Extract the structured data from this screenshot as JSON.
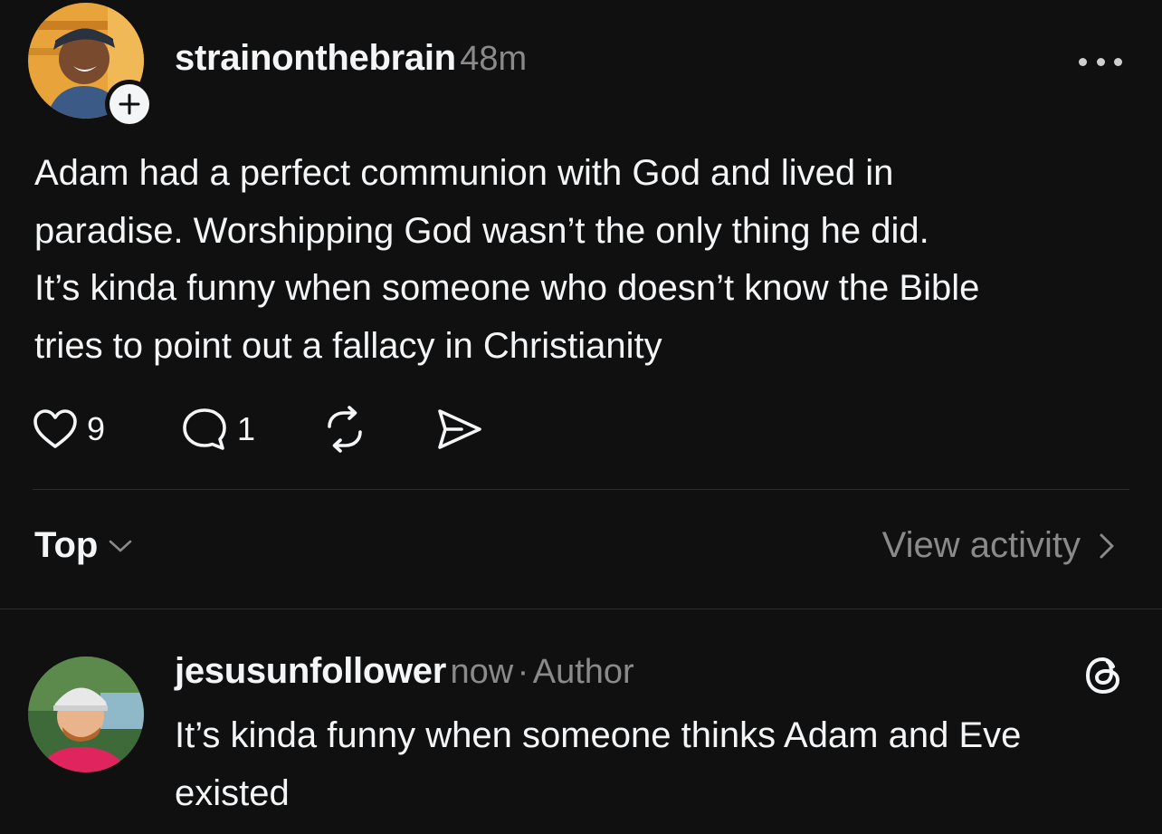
{
  "post": {
    "username": "strainonthebrain",
    "time": "48m",
    "text": "Adam had a perfect communion with God and lived in\nparadise. Worshipping God wasn’t the only thing he did.\nIt’s kinda funny when someone who doesn’t know the Bible\ntries to point out a fallacy in Christianity",
    "likes": "9",
    "comments": "1",
    "icons": {
      "more": "more-horizontal-icon",
      "follow": "plus-icon",
      "like": "heart-icon",
      "comment": "comment-icon",
      "repost": "repost-icon",
      "share": "send-icon"
    }
  },
  "sort": {
    "label": "Top",
    "view_activity": "View activity"
  },
  "reply": {
    "username": "jesusunfollower",
    "time": "now",
    "separator": "·",
    "badge": "Author",
    "text": "It’s kinda funny when someone thinks Adam and Eve existed",
    "icon": "threads-logo-icon"
  },
  "colors": {
    "background": "#101010",
    "text_primary": "#f3f5f7",
    "text_secondary": "#8a8a8a",
    "divider": "#2d2d2d"
  }
}
